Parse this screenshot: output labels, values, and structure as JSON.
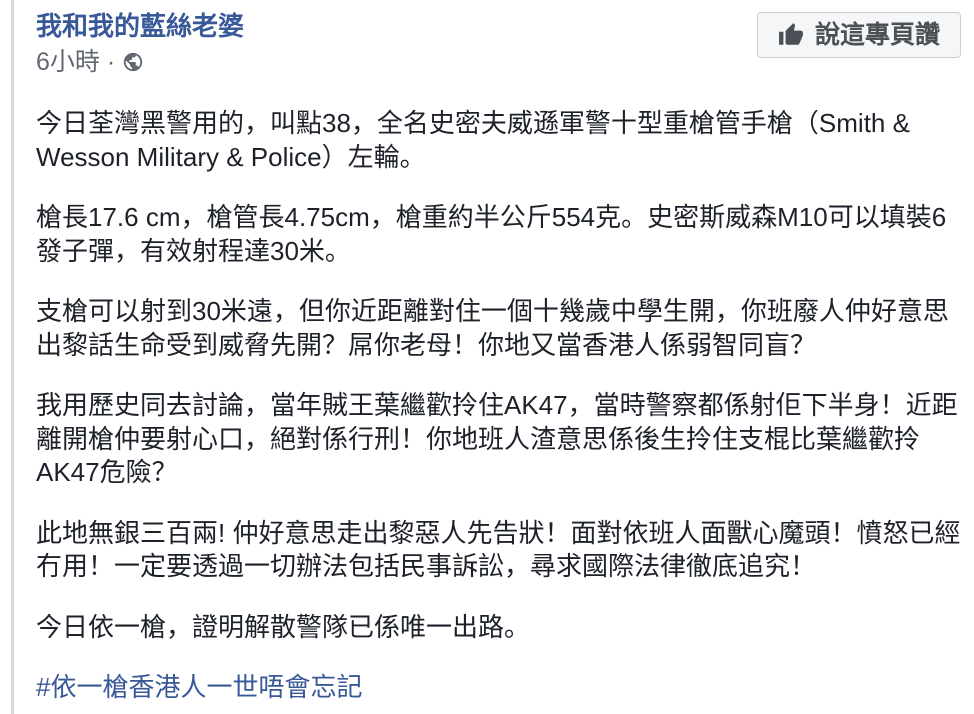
{
  "post": {
    "page_name": "我和我的藍絲老婆",
    "timestamp": "6小時",
    "separator": "·",
    "privacy_icon": "globe-icon",
    "like_page_button": {
      "icon": "thumbs-up-icon",
      "label": "說這專頁讚"
    },
    "paragraphs": [
      [
        "今日荃灣黑警用的，叫點38，全名史密夫威遜軍警十型重槍管手槍（Smith &",
        "Wesson Military & Police）左輪。"
      ],
      [
        "槍長17.6 cm，槍管長4.75cm，槍重約半公斤554克。史密斯威森M10可以填裝6",
        "發子彈，有效射程達30米。"
      ],
      [
        "支槍可以射到30米遠，但你近距離對住一個十幾歲中學生開，你班廢人仲好意思",
        "出黎話生命受到威脅先開？屌你老母！你地又當香港人係弱智同盲？"
      ],
      [
        "我用歷史同去討論，當年賊王葉繼歡拎住AK47，當時警察都係射佢下半身！近距",
        "離開槍仲要射心口，絕對係行刑！你地班人渣意思係後生拎住支棍比葉繼歡拎",
        "AK47危險？"
      ],
      [
        "此地無銀三百兩! 仲好意思走出黎惡人先告狀！面對依班人面獸心魔頭！憤怒已經",
        "冇用！一定要透過一切辦法包括民事訴訟，尋求國際法律徹底追究！"
      ],
      [
        "今日依一槍，證明解散警隊已係唯一出路。"
      ]
    ],
    "hashtag": "#依一槍香港人一世唔會忘記"
  },
  "colors": {
    "link": "#385898",
    "text": "#1d2129",
    "meta": "#616770",
    "button_bg": "#f5f6f7",
    "button_border": "#ccd0d5",
    "button_text": "#4b4f56",
    "left_rule": "#d4d7dc"
  }
}
